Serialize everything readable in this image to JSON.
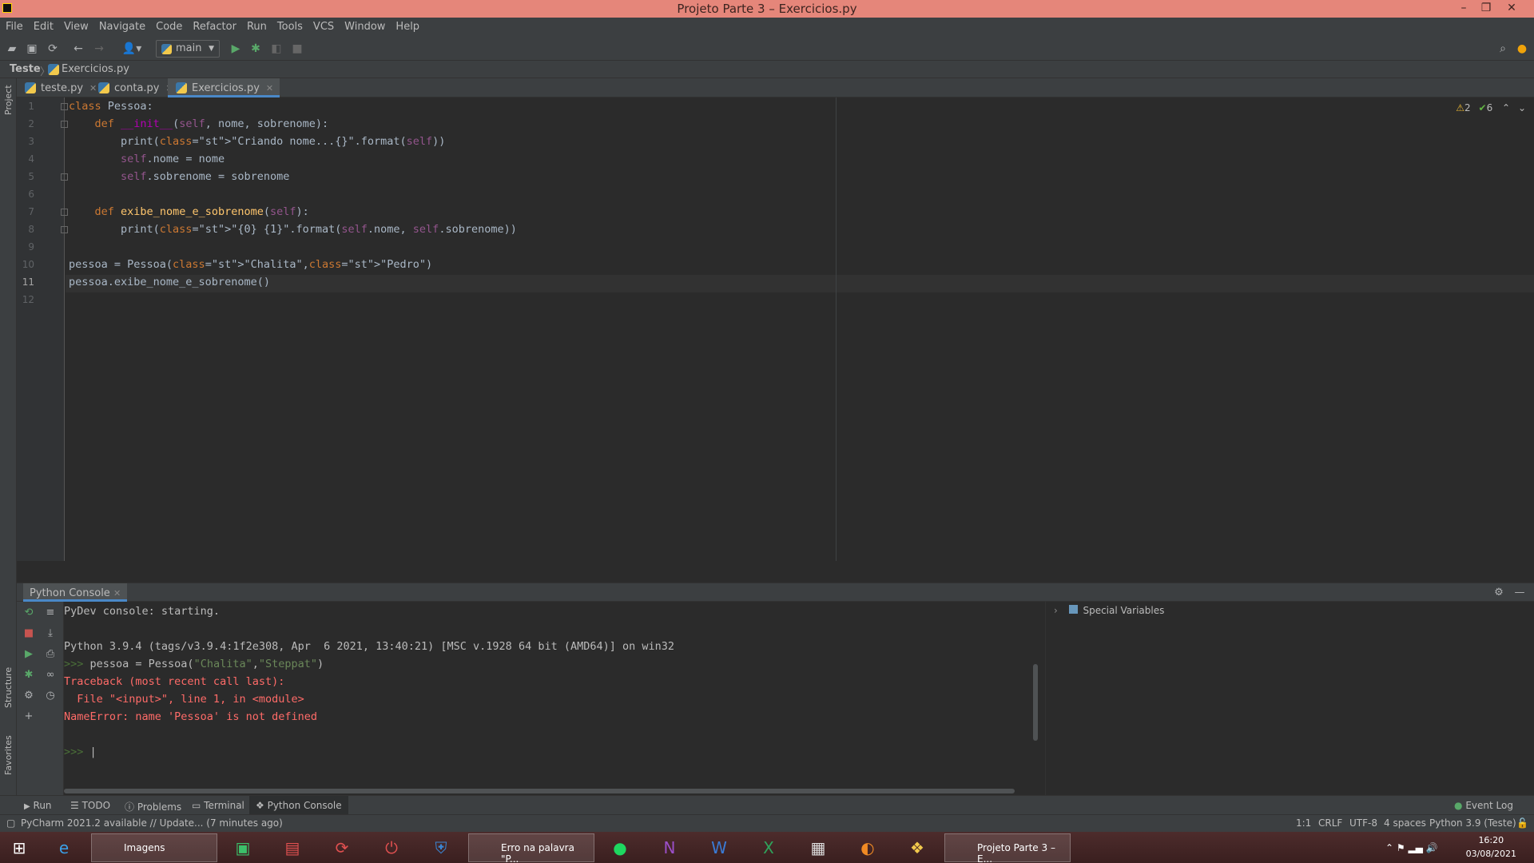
{
  "window": {
    "title": "Projeto Parte 3 – Exercicios.py"
  },
  "menu": [
    "File",
    "Edit",
    "View",
    "Navigate",
    "Code",
    "Refactor",
    "Run",
    "Tools",
    "VCS",
    "Window",
    "Help"
  ],
  "toolbar": {
    "run_config": "main"
  },
  "breadcrumb": {
    "project": "Teste",
    "file": "Exercicios.py"
  },
  "left_stripe": {
    "project": "Project",
    "structure": "Structure",
    "favorites": "Favorites"
  },
  "tabs": [
    {
      "label": "teste.py"
    },
    {
      "label": "conta.py"
    },
    {
      "label": "Exercicios.py",
      "active": true
    }
  ],
  "editor": {
    "line_numbers": [
      "1",
      "2",
      "3",
      "4",
      "5",
      "6",
      "7",
      "8",
      "9",
      "10",
      "11",
      "12"
    ],
    "current_line": 11,
    "inspections": {
      "warnings": "2",
      "ok": "6"
    },
    "code": [
      {
        "t": "class Pessoa:"
      },
      {
        "t": "    def __init__(self, nome, sobrenome):"
      },
      {
        "t": "        print(\"Criando nome...{}\".format(self))"
      },
      {
        "t": "        self.nome = nome"
      },
      {
        "t": "        self.sobrenome = sobrenome"
      },
      {
        "t": ""
      },
      {
        "t": "    def exibe_nome_e_sobrenome(self):"
      },
      {
        "t": "        print(\"{0} {1}\".format(self.nome, self.sobrenome))"
      },
      {
        "t": ""
      },
      {
        "t": "pessoa = Pessoa(\"Chalita\",\"Pedro\")"
      },
      {
        "t": "pessoa.exibe_nome_e_sobrenome()"
      },
      {
        "t": ""
      }
    ]
  },
  "console": {
    "tab_label": "Python Console",
    "lines": [
      "PyDev console: starting.",
      "",
      "Python 3.9.4 (tags/v3.9.4:1f2e308, Apr  6 2021, 13:40:21) [MSC v.1928 64 bit (AMD64)] on win32",
      ">>> pessoa = Pessoa(\"Chalita\",\"Steppat\")",
      "Traceback (most recent call last):",
      "  File \"<input>\", line 1, in <module>",
      "NameError: name 'Pessoa' is not defined"
    ],
    "prompt": ">>>",
    "special_variables": "Special Variables"
  },
  "tool_windows": [
    "Run",
    "TODO",
    "Problems",
    "Terminal",
    "Python Console"
  ],
  "event_log": "Event Log",
  "status": {
    "message": "PyCharm 2021.2 available // Update... (7 minutes ago)",
    "position": "1:1",
    "line_sep": "CRLF",
    "encoding": "UTF-8",
    "indent": "4 spaces",
    "interpreter": "Python 3.9 (Teste)"
  },
  "taskbar": {
    "items": [
      {
        "label": "Imagens"
      },
      {
        "label": "Erro na palavra \"P..."
      },
      {
        "label": "Projeto Parte 3 – E..."
      }
    ],
    "time": "16:20",
    "date": "03/08/2021"
  },
  "colors": {
    "title_bar": "#e5867a",
    "editor_bg": "#2b2b2b",
    "keyword": "#cc7832",
    "string": "#6a8759",
    "error": "#ff6b68",
    "accent": "#4a88c7"
  }
}
